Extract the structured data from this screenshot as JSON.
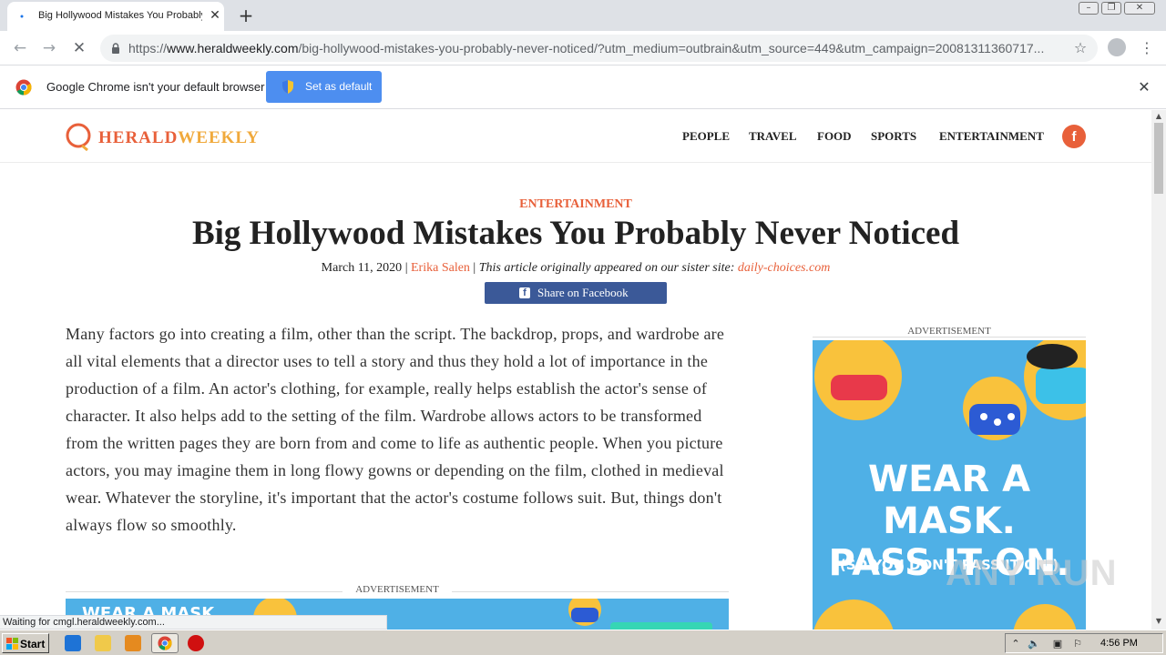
{
  "browser": {
    "tab_title": "Big Hollywood Mistakes You Probably",
    "tab_close": "✕",
    "new_tab": "+",
    "url_scheme": "https://",
    "url_host": "www.heraldweekly.com",
    "url_path": "/big-hollywood-mistakes-you-probably-never-noticed/?utm_medium=outbrain&utm_source=449&utm_campaign=20081311360717...",
    "infobar_message": "Google Chrome isn't your default browser",
    "set_default_label": "Set as default",
    "status_text": "Waiting for cmgl.heraldweekly.com..."
  },
  "site": {
    "logo_part1": "HERALD",
    "logo_part2": "WEEKLY",
    "nav": [
      "PEOPLE",
      "TRAVEL",
      "FOOD",
      "SPORTS",
      "ENTERTAINMENT"
    ],
    "fb_letter": "f"
  },
  "article": {
    "category": "ENTERTAINMENT",
    "title": "Big Hollywood Mistakes You Probably Never Noticed",
    "date": "March 11, 2020",
    "author": "Erika Salen",
    "origin_note": "This article originally appeared on our sister site:",
    "origin_site": "daily-choices.com",
    "share_label": "Share on Facebook",
    "body": "Many factors go into creating a film, other than the script. The backdrop, props, and wardrobe are all vital elements that a director uses to tell a story and thus they hold a lot of importance in the production of a film. An actor's clothing, for example, really helps establish the actor's sense of character. It also helps add to the setting of the film. Wardrobe allows actors to be transformed from the written pages they are born from and come to life as authentic people. When you picture actors, you may imagine them in long flowy gowns or depending on the film, clothed in medieval wear. Whatever the storyline, it's important that the actor's costume follows suit. But, things don't always flow so smoothly."
  },
  "ads": {
    "label": "ADVERTISEMENT",
    "side_headline_1": "WEAR A MASK.",
    "side_headline_2": "PASS IT ON.",
    "side_sub": "(SO YOU DON'T PASS IT ON.)",
    "bottom_text": "WEAR A MASK"
  },
  "taskbar": {
    "start_label": "Start",
    "clock": "4:56 PM"
  },
  "watermark": "ANY RUN",
  "colors": {
    "accent": "#e8603a",
    "facebook": "#3b5998",
    "ad_blue": "#4fb0e6",
    "chrome_button": "#4d8ef0"
  }
}
